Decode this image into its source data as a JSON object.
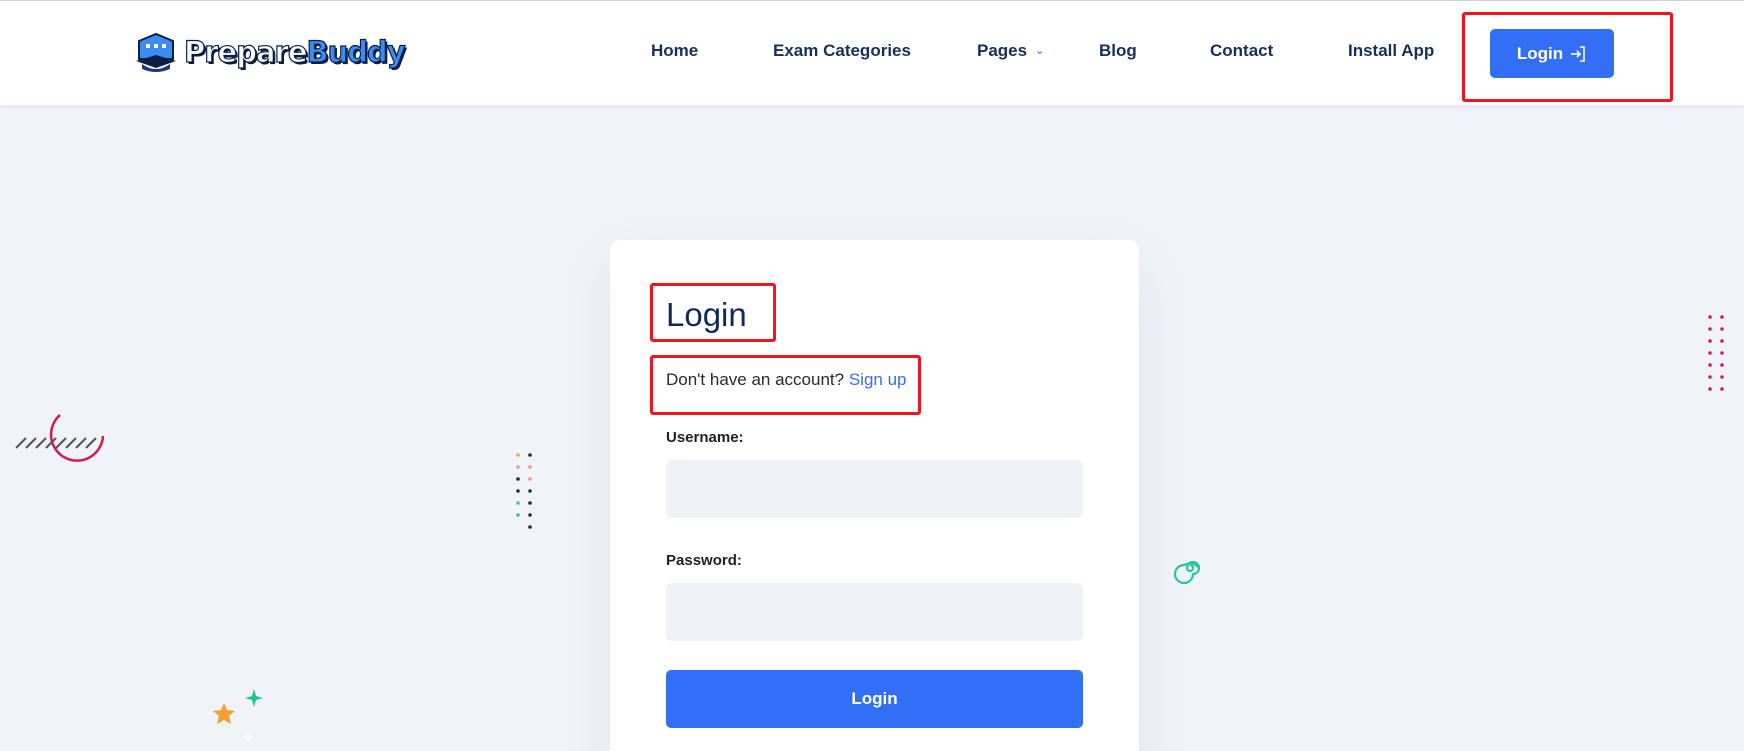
{
  "header": {
    "logo": {
      "text_part1": "Prepare",
      "text_part2": "Buddy",
      "icon": "graduation-building-icon"
    },
    "nav": [
      {
        "label": "Home"
      },
      {
        "label": "Exam Categories"
      },
      {
        "label": "Pages",
        "has_dropdown": true
      },
      {
        "label": "Blog"
      },
      {
        "label": "Contact"
      },
      {
        "label": "Install App"
      }
    ],
    "login_button": {
      "label": "Login",
      "icon": "login-arrow-icon"
    }
  },
  "login_card": {
    "title": "Login",
    "signup_prompt": "Don't have an account?",
    "signup_link": "Sign up",
    "username": {
      "label": "Username:",
      "value": "",
      "placeholder": ""
    },
    "password": {
      "label": "Password:",
      "value": "",
      "placeholder": ""
    },
    "submit_label": "Login"
  },
  "colors": {
    "accent": "#326ff5",
    "nav_text": "#17305a",
    "background": "#f0f3f8",
    "annotation": "#f0141e"
  }
}
